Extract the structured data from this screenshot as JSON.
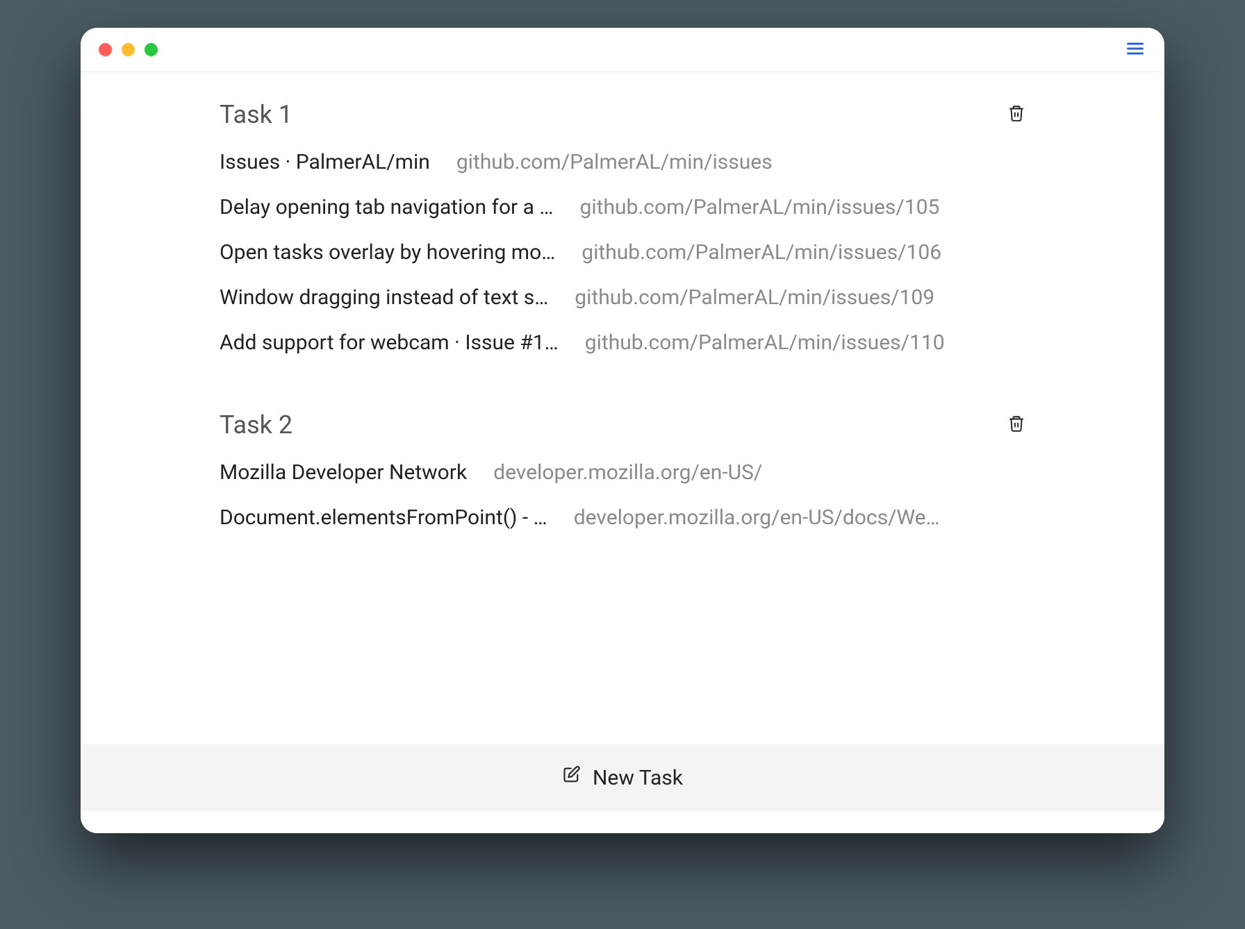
{
  "tasks": [
    {
      "name": "Task 1",
      "tabs": [
        {
          "title": "Issues · PalmerAL/min",
          "url": "github.com/PalmerAL/min/issues"
        },
        {
          "title": "Delay opening tab navigation for a …",
          "url": "github.com/PalmerAL/min/issues/105"
        },
        {
          "title": "Open tasks overlay by hovering mo…",
          "url": "github.com/PalmerAL/min/issues/106"
        },
        {
          "title": "Window dragging instead of text s…",
          "url": "github.com/PalmerAL/min/issues/109"
        },
        {
          "title": "Add support for webcam · Issue #1…",
          "url": "github.com/PalmerAL/min/issues/110"
        }
      ]
    },
    {
      "name": "Task 2",
      "tabs": [
        {
          "title": "Mozilla Developer Network",
          "url": "developer.mozilla.org/en-US/"
        },
        {
          "title": "Document.elementsFromPoint() - …",
          "url": "developer.mozilla.org/en-US/docs/We…"
        }
      ]
    }
  ],
  "newTaskLabel": "New Task"
}
